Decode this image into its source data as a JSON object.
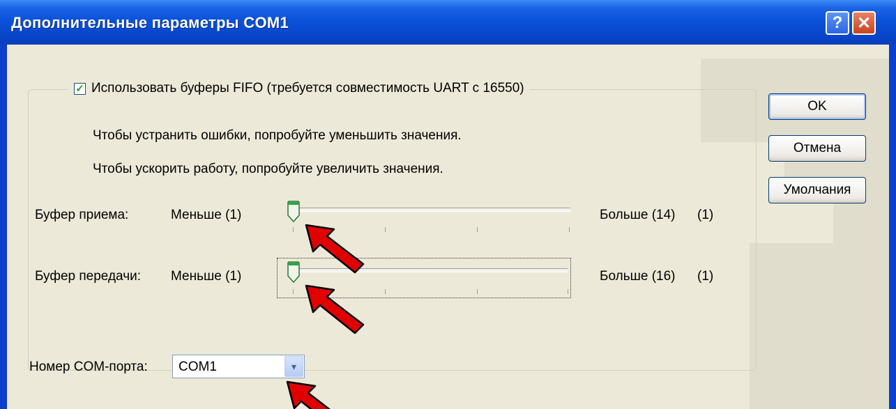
{
  "window": {
    "title": "Дополнительные параметры COM1",
    "help_label": "?",
    "close_label": "✕"
  },
  "fifo": {
    "checkbox_mark": "✓",
    "label": "Использовать буферы FIFO (требуется совместимость UART с 16550)",
    "checked": true
  },
  "hints": {
    "line1": "Чтобы устранить ошибки, попробуйте уменьшить значения.",
    "line2": "Чтобы ускорить работу, попробуйте увеличить значения."
  },
  "receive_buffer": {
    "label": "Буфер приема:",
    "min_label": "Меньше (1)",
    "max_label": "Больше (14)",
    "value": "(1)"
  },
  "transmit_buffer": {
    "label": "Буфер передачи:",
    "min_label": "Меньше (1)",
    "max_label": "Больше (16)",
    "value": "(1)"
  },
  "com_port": {
    "label": "Номер COM-порта:",
    "selected": "COM1",
    "dropdown_glyph": "▾"
  },
  "buttons": {
    "ok": "OK",
    "cancel": "Отмена",
    "defaults": "Умолчания"
  },
  "colors": {
    "accent": "#0a52d9",
    "arrow": "#e00000",
    "dialog_bg": "#ece9d8"
  }
}
